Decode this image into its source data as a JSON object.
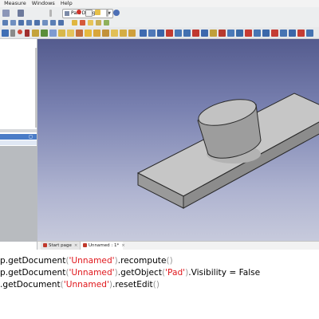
{
  "menubar": {
    "cut_item": "",
    "items": [
      "Measure",
      "Windows",
      "Help"
    ]
  },
  "toolbar": {
    "workbench_selector": "Part Design"
  },
  "tabs": [
    {
      "label": "Start page",
      "close": "×"
    },
    {
      "label": "Unnamed : 1*",
      "close": "×"
    }
  ],
  "console": {
    "lines": [
      [
        {
          "t": "p.getDocument",
          "c": "plain"
        },
        {
          "t": "(",
          "c": "paren"
        },
        {
          "t": "'Unnamed'",
          "c": "str"
        },
        {
          "t": ")",
          "c": "paren"
        },
        {
          "t": ".recompute",
          "c": "plain"
        },
        {
          "t": "()",
          "c": "paren"
        }
      ],
      [
        {
          "t": "p.getDocument",
          "c": "plain"
        },
        {
          "t": "(",
          "c": "paren"
        },
        {
          "t": "'Unnamed'",
          "c": "str"
        },
        {
          "t": ")",
          "c": "paren"
        },
        {
          "t": ".getObject",
          "c": "plain"
        },
        {
          "t": "(",
          "c": "paren"
        },
        {
          "t": "'Pad'",
          "c": "str"
        },
        {
          "t": ")",
          "c": "paren"
        },
        {
          "t": ".Visibility = False",
          "c": "plain"
        }
      ],
      [
        {
          "t": ".getDocument",
          "c": "plain"
        },
        {
          "t": "(",
          "c": "paren"
        },
        {
          "t": "'Unnamed'",
          "c": "str"
        },
        {
          "t": ")",
          "c": "paren"
        },
        {
          "t": ".resetEdit",
          "c": "plain"
        },
        {
          "t": "()",
          "c": "paren"
        }
      ]
    ]
  },
  "icons": {
    "toolbar1": [
      "shield-icon",
      "arrow-icon",
      "new-doc-icon",
      "open-icon",
      "save-icon",
      "macro-record-icon",
      "macro-stop-icon",
      "edit-macro-icon",
      "run-macro-icon",
      "help-icon",
      "whats-this-icon"
    ],
    "toolbar2": [
      "view-fit-icon",
      "view-iso-icon",
      "view-front-icon",
      "view-top-icon",
      "view-right-icon",
      "view-rear-icon",
      "view-bottom-icon",
      "view-left-icon",
      "part-icon",
      "sketch-icon",
      "body-icon",
      "pad-icon",
      "pocket-icon"
    ],
    "toolbar3": [
      "sketcher-icon",
      "select-icon",
      "point-icon",
      "line-icon",
      "plane-icon",
      "lcs-icon",
      "shape-binder-icon",
      "clone-icon",
      "pad-icon",
      "pocket-icon",
      "hole-icon",
      "revolve-icon",
      "groove-icon",
      "loft-icon",
      "sweep-icon",
      "helix-icon",
      "add-box-icon",
      "sub-box-icon",
      "fillet-icon",
      "chamfer-icon",
      "draft-icon",
      "thickness-icon",
      "mirror-icon",
      "linear-pattern-icon",
      "polar-pattern-icon",
      "scale-icon",
      "multitransform-icon"
    ]
  },
  "colors": {
    "view_top": "#545b8e",
    "view_bottom": "#c7cadc",
    "string": "#e0161b",
    "selection": "#4a7cc7"
  }
}
